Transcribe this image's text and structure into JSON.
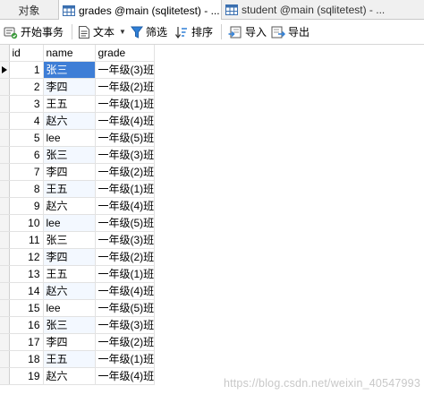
{
  "tabs": [
    {
      "label": "对象",
      "icon": "none"
    },
    {
      "label": "grades @main (sqlitetest) - ...",
      "icon": "table-icon"
    },
    {
      "label": "student @main (sqlitetest) - ...",
      "icon": "table-icon"
    }
  ],
  "toolbar": {
    "begin_transaction": "开始事务",
    "text": "文本",
    "filter": "筛选",
    "sort": "排序",
    "import": "导入",
    "export": "导出"
  },
  "columns": [
    "id",
    "name",
    "grade"
  ],
  "rows": [
    {
      "id": "1",
      "name": "张三",
      "grade": "一年级(3)班"
    },
    {
      "id": "2",
      "name": "李四",
      "grade": "一年级(2)班"
    },
    {
      "id": "3",
      "name": "王五",
      "grade": "一年级(1)班"
    },
    {
      "id": "4",
      "name": "赵六",
      "grade": "一年级(4)班"
    },
    {
      "id": "5",
      "name": "lee",
      "grade": "一年级(5)班"
    },
    {
      "id": "6",
      "name": "张三",
      "grade": "一年级(3)班"
    },
    {
      "id": "7",
      "name": "李四",
      "grade": "一年级(2)班"
    },
    {
      "id": "8",
      "name": "王五",
      "grade": "一年级(1)班"
    },
    {
      "id": "9",
      "name": "赵六",
      "grade": "一年级(4)班"
    },
    {
      "id": "10",
      "name": "lee",
      "grade": "一年级(5)班"
    },
    {
      "id": "11",
      "name": "张三",
      "grade": "一年级(3)班"
    },
    {
      "id": "12",
      "name": "李四",
      "grade": "一年级(2)班"
    },
    {
      "id": "13",
      "name": "王五",
      "grade": "一年级(1)班"
    },
    {
      "id": "14",
      "name": "赵六",
      "grade": "一年级(4)班"
    },
    {
      "id": "15",
      "name": "lee",
      "grade": "一年级(5)班"
    },
    {
      "id": "16",
      "name": "张三",
      "grade": "一年级(3)班"
    },
    {
      "id": "17",
      "name": "李四",
      "grade": "一年级(2)班"
    },
    {
      "id": "18",
      "name": "王五",
      "grade": "一年级(1)班"
    },
    {
      "id": "19",
      "name": "赵六",
      "grade": "一年级(4)班"
    }
  ],
  "watermark": "https://blog.csdn.net/weixin_40547993",
  "colors": {
    "selection": "#3e7ed6",
    "tab_active": "#ffffff"
  }
}
